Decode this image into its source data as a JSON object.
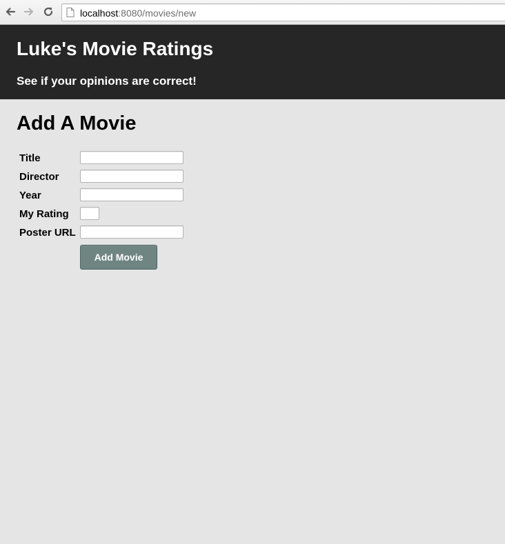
{
  "browser": {
    "url_host": "localhost",
    "url_rest": ":8080/movies/new"
  },
  "header": {
    "title": "Luke's Movie Ratings",
    "subtitle": "See if your opinions are correct!"
  },
  "main": {
    "heading": "Add A Movie",
    "form": {
      "fields": [
        {
          "label": "Title",
          "value": ""
        },
        {
          "label": "Director",
          "value": ""
        },
        {
          "label": "Year",
          "value": ""
        },
        {
          "label": "My Rating",
          "value": ""
        },
        {
          "label": "Poster URL",
          "value": ""
        }
      ],
      "submit_label": "Add Movie"
    }
  },
  "colors": {
    "header_bg": "#262626",
    "page_bg": "#e5e5e5",
    "button_bg": "#6e8582"
  },
  "icons": {
    "back": "back-arrow-icon",
    "forward": "forward-arrow-icon",
    "reload": "reload-icon",
    "page": "page-icon"
  }
}
